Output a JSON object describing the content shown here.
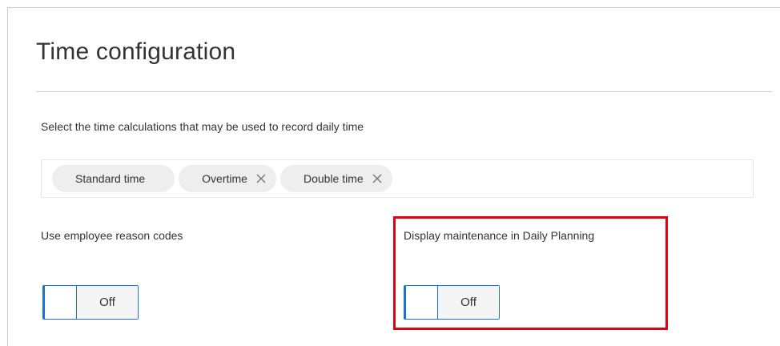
{
  "page": {
    "title": "Time configuration",
    "instruction": "Select the time calculations that may be used to record daily time"
  },
  "time_calculations": {
    "chips": [
      {
        "label": "Standard time",
        "removable": false
      },
      {
        "label": "Overtime",
        "removable": true
      },
      {
        "label": "Double time",
        "removable": true
      }
    ],
    "remove_icon": "close-icon"
  },
  "settings": {
    "employee_reason_codes": {
      "label": "Use employee reason codes",
      "toggle_state": "Off"
    },
    "display_maintenance": {
      "label": "Display maintenance in Daily Planning",
      "toggle_state": "Off"
    }
  },
  "colors": {
    "accent": "#1a73c8",
    "highlight": "#e3000f",
    "chip_background": "#eeeeee"
  }
}
